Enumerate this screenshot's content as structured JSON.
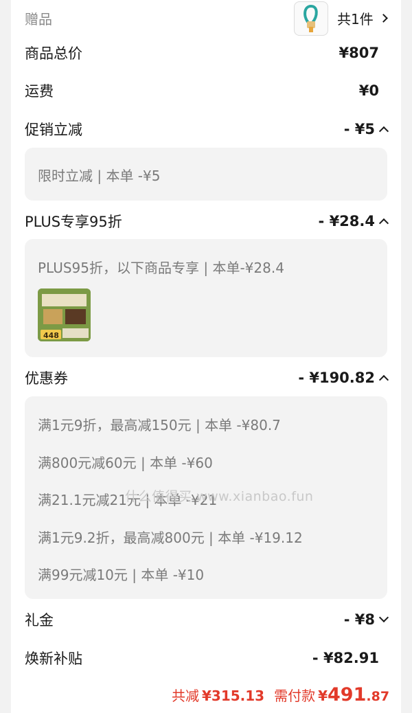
{
  "gift": {
    "label": "赠品",
    "count": "共1件"
  },
  "rows": {
    "total_price": {
      "label": "商品总价",
      "value": "¥807"
    },
    "shipping": {
      "label": "运费",
      "value": "¥0"
    },
    "promo": {
      "label": "促销立减",
      "value": "- ¥5"
    },
    "plus": {
      "label": "PLUS专享95折",
      "value": "- ¥28.4"
    },
    "coupon": {
      "label": "优惠券",
      "value": "- ¥190.82"
    },
    "gift_money": {
      "label": "礼金",
      "value": "- ¥8"
    },
    "renewal": {
      "label": "焕新补贴",
      "value": "- ¥82.91"
    }
  },
  "promo_detail": "限时立减 | 本单 -¥5",
  "plus_detail": {
    "text": "PLUS95折，以下商品专享 | 本单-¥28.4",
    "thumb_price": "448"
  },
  "coupon_items": [
    "满1元9折，最高减150元 | 本单 -¥80.7",
    "满800元减60元 | 本单 -¥60",
    "满21.1元减21元 | 本单 -¥21",
    "满1元9.2折，最高减800元 | 本单 -¥19.12",
    "满99元减10元 | 本单 -¥10"
  ],
  "watermark": "什么值得买 www.xianbao.fun",
  "summary": {
    "saved_label": "共减",
    "saved_value": "¥315.13",
    "pay_label": "需付款",
    "pay_currency": "¥",
    "pay_int": "491",
    "pay_dec": ".87"
  },
  "colors": {
    "accent": "#e23a2a",
    "panel": "#f3f3f3",
    "muted": "#7a7a7a"
  }
}
